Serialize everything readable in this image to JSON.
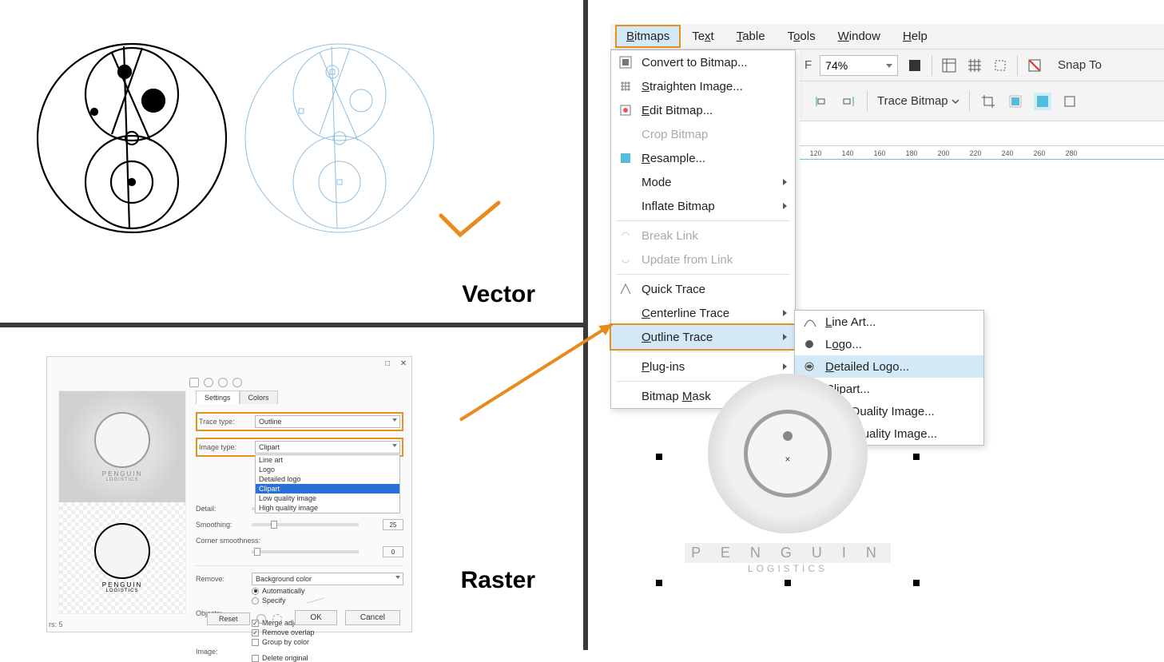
{
  "panel_labels": {
    "vector": "Vector",
    "raster": "Raster"
  },
  "corel": {
    "menubar": [
      "Bitmaps",
      "Text",
      "Table",
      "Tools",
      "Window",
      "Help"
    ],
    "active_menu": "Bitmaps",
    "zoom": "74%",
    "snap_to": "Snap To",
    "trace_bitmap": "Trace Bitmap",
    "ruler_ticks": [
      120,
      140,
      160,
      180,
      200,
      220,
      240,
      260,
      280
    ],
    "bitmaps_menu": [
      {
        "label": "Convert to Bitmap...",
        "type": "item"
      },
      {
        "label": "Straighten Image...",
        "type": "item"
      },
      {
        "label": "Edit Bitmap...",
        "type": "item"
      },
      {
        "label": "Crop Bitmap",
        "type": "item",
        "disabled": true
      },
      {
        "label": "Resample...",
        "type": "item"
      },
      {
        "label": "Mode",
        "type": "sub"
      },
      {
        "label": "Inflate Bitmap",
        "type": "sub"
      },
      {
        "type": "sep"
      },
      {
        "label": "Break Link",
        "type": "item",
        "disabled": true
      },
      {
        "label": "Update from Link",
        "type": "item",
        "disabled": true
      },
      {
        "type": "sep"
      },
      {
        "label": "Quick Trace",
        "type": "item"
      },
      {
        "label": "Centerline Trace",
        "type": "sub"
      },
      {
        "label": "Outline Trace",
        "type": "sub",
        "highlight": true
      },
      {
        "type": "sep"
      },
      {
        "label": "Plug-ins",
        "type": "sub"
      },
      {
        "type": "sep"
      },
      {
        "label": "Bitmap Mask",
        "type": "item"
      }
    ],
    "outline_submenu": [
      {
        "label": "Line Art..."
      },
      {
        "label": "Logo..."
      },
      {
        "label": "Detailed Logo...",
        "highlight": true
      },
      {
        "label": "Clipart..."
      },
      {
        "label": "Low Quality Image..."
      },
      {
        "label": "High Quality Image..."
      }
    ],
    "canvas_logo": {
      "line1": "P E N G U I N",
      "line2": "LOGISTICS"
    }
  },
  "trace_dialog": {
    "tabs": [
      "Settings",
      "Colors"
    ],
    "trace_type_label": "Trace type:",
    "trace_type_value": "Outline",
    "image_type_label": "Image type:",
    "image_type_value": "Clipart",
    "image_type_options": [
      "Line art",
      "Logo",
      "Detailed logo",
      "Clipart",
      "Low quality image",
      "High quality image"
    ],
    "detail_label": "Detail:",
    "smoothing_label": "Smoothing:",
    "smoothing_value": "25",
    "corner_label": "Corner smoothness:",
    "corner_value": "0",
    "remove_label": "Remove:",
    "remove_value": "Background color",
    "auto": "Automatically",
    "specify": "Specify",
    "objects_label": "Objects:",
    "merge_adjacent": "Merge adjacent",
    "remove_overlap": "Remove overlap",
    "group_by_color": "Group by color",
    "image_label": "Image:",
    "delete_original": "Delete original",
    "reset": "Reset",
    "ok": "OK",
    "cancel": "Cancel",
    "layers": "rs:   5",
    "logo_text": "PENGUIN",
    "logo_sub": "LOGISTICS"
  }
}
